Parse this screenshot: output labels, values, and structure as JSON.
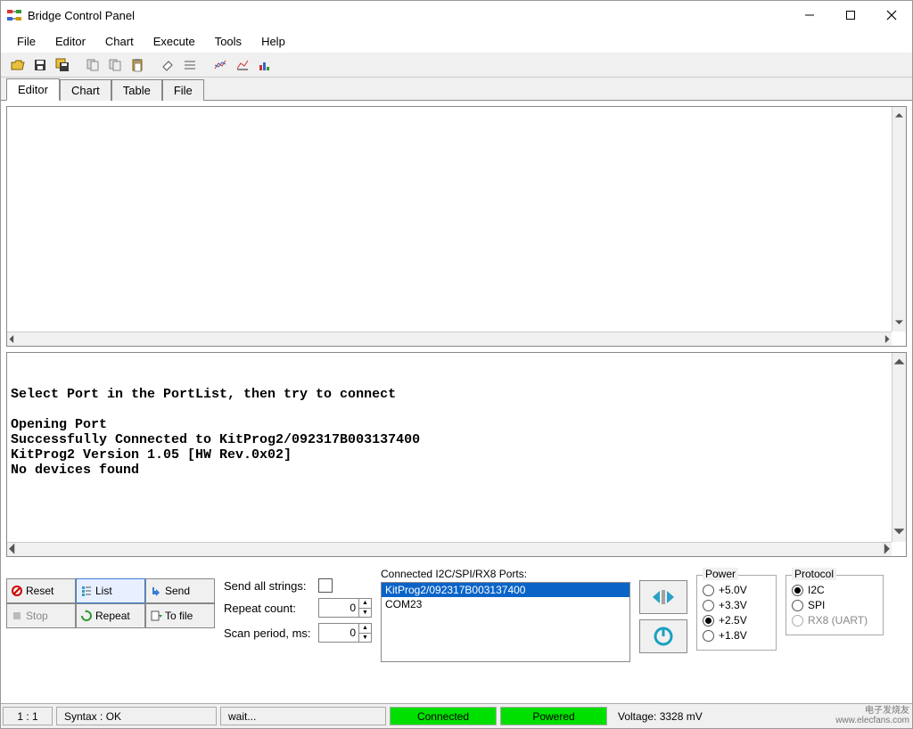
{
  "window": {
    "title": "Bridge Control Panel"
  },
  "menu": {
    "items": [
      "File",
      "Editor",
      "Chart",
      "Execute",
      "Tools",
      "Help"
    ]
  },
  "tabs": {
    "items": [
      "Editor",
      "Chart",
      "Table",
      "File"
    ],
    "active": 0
  },
  "toolbar": {
    "icons": [
      "open",
      "save",
      "save-all",
      "copy",
      "copy2",
      "paste",
      "eraser",
      "list",
      "chart1",
      "chart2",
      "chart3"
    ]
  },
  "log": {
    "text": "Select Port in the PortList, then try to connect\n\nOpening Port\nSuccessfully Connected to KitProg2/092317B003137400\nKitProg2 Version 1.05 [HW Rev.0x02]\nNo devices found"
  },
  "buttons": {
    "reset": "Reset",
    "list": "List",
    "send": "Send",
    "stop": "Stop",
    "repeat": "Repeat",
    "tofile": "To file"
  },
  "form": {
    "send_all_label": "Send all strings:",
    "repeat_count_label": "Repeat count:",
    "repeat_count_value": "0",
    "scan_period_label": "Scan period, ms:",
    "scan_period_value": "0"
  },
  "ports": {
    "label": "Connected I2C/SPI/RX8 Ports:",
    "items": [
      "KitProg2/092317B003137400",
      "COM23"
    ],
    "selected": 0
  },
  "power": {
    "label": "Power",
    "options": [
      "+5.0V",
      "+3.3V",
      "+2.5V",
      "+1.8V"
    ],
    "selected": 2
  },
  "protocol": {
    "label": "Protocol",
    "options": [
      "I2C",
      "SPI",
      "RX8 (UART)"
    ],
    "selected": 0,
    "disabled": [
      2
    ]
  },
  "status": {
    "pos": "1 : 1",
    "syntax": "Syntax : OK",
    "wait": "wait...",
    "connected": "Connected",
    "powered": "Powered",
    "voltage": "Voltage: 3328 mV"
  },
  "attribution": {
    "line1": "电子发烧友",
    "line2": "www.elecfans.com"
  }
}
